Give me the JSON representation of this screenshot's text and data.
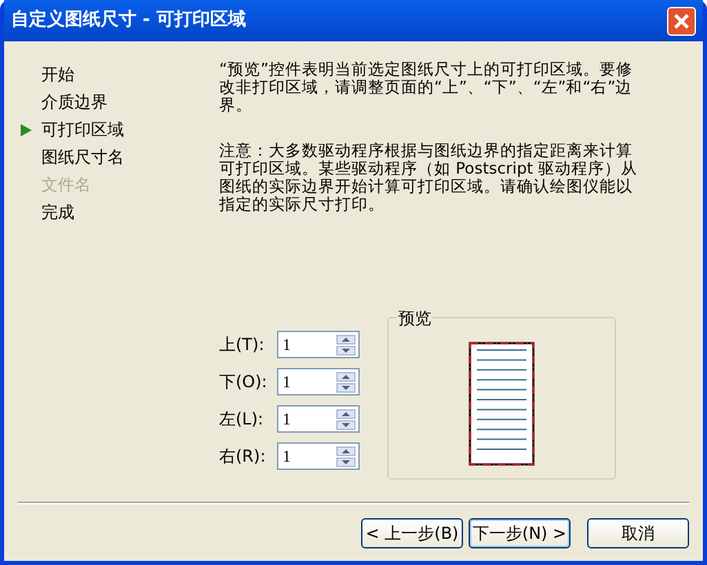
{
  "window": {
    "title": "自定义图纸尺寸 - 可打印区域"
  },
  "steps": [
    {
      "label": "开始",
      "selected": false,
      "disabled": false
    },
    {
      "label": "介质边界",
      "selected": false,
      "disabled": false
    },
    {
      "label": "可打印区域",
      "selected": true,
      "disabled": false
    },
    {
      "label": "图纸尺寸名",
      "selected": false,
      "disabled": false
    },
    {
      "label": "文件名",
      "selected": false,
      "disabled": true
    },
    {
      "label": "完成",
      "selected": false,
      "disabled": false
    }
  ],
  "paragraphs": [
    "“预览”控件表明当前选定图纸尺寸上的可打印区域。要修改非打印区域，请调整页面的“上”、“下”、“左”和“右”边界。",
    "注意：大多数驱动程序根据与图纸边界的指定距离来计算可打印区域。某些驱动程序（如 Postscript 驱动程序）从图纸的实际边界开始计算可打印区域。请确认绘图仪能以指定的实际尺寸打印。"
  ],
  "margins": [
    {
      "label": "上(T):",
      "value": "1"
    },
    {
      "label": "下(O):",
      "value": "1"
    },
    {
      "label": "左(L):",
      "value": "1"
    },
    {
      "label": "右(R):",
      "value": "1"
    }
  ],
  "preview": {
    "title": "预览"
  },
  "buttons": [
    {
      "label": "< 上一步(B)",
      "kind": "normal"
    },
    {
      "label": "下一步(N) >",
      "kind": "default"
    },
    {
      "label": "取消",
      "kind": "normal"
    }
  ]
}
